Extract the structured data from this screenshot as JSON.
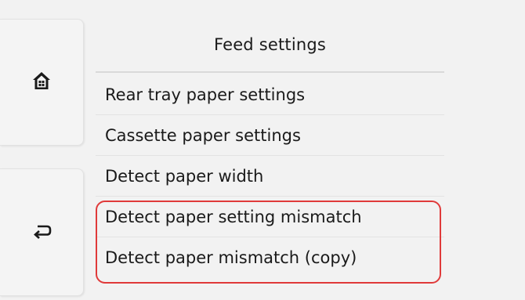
{
  "screen": {
    "title": "Feed settings"
  },
  "nav": {
    "home_icon": "home-icon",
    "back_icon": "back-arrow-icon"
  },
  "menu": {
    "items": [
      {
        "label": "Rear tray paper settings"
      },
      {
        "label": "Cassette paper settings"
      },
      {
        "label": "Detect paper width"
      },
      {
        "label": "Detect paper setting mismatch"
      },
      {
        "label": "Detect paper mismatch (copy)"
      }
    ]
  },
  "highlight": {
    "color": "#e03a3a"
  }
}
